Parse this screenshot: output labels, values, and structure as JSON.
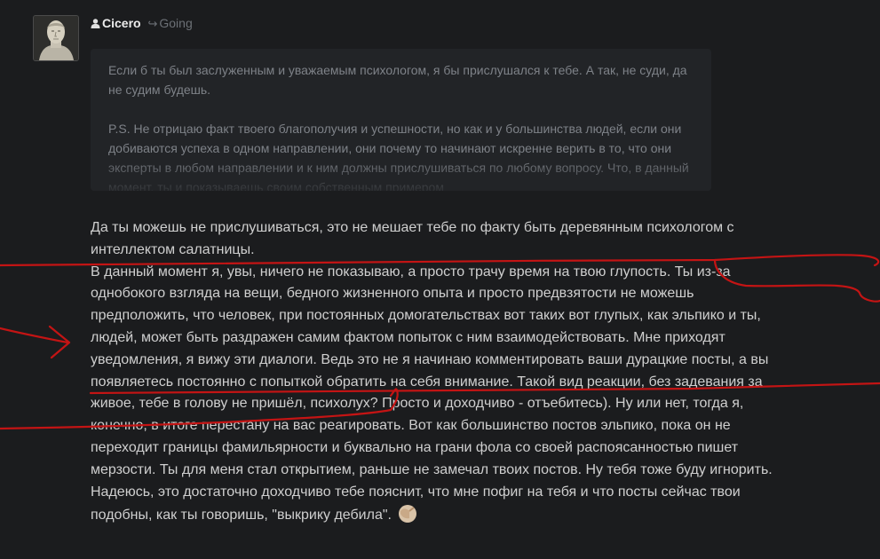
{
  "post": {
    "author": "Cicero",
    "reply_label": "Going",
    "avatar_icon": "bust-avatar",
    "quote": {
      "p1": "Если б ты был заслуженным и уважаемым психологом, я бы прислушался к тебе. А так, не суди, да не судим будешь.",
      "p2": "P.S. Не отрицаю факт твоего благополучия и успешности, но как и у большинства людей, если они добиваются успеха в одном направлении, они почему то начинают искренне верить в то, что они эксперты в любом направлении и к ним должны прислушиваться по любому вопросу. Что, в данный момент, ты и показываешь своим собственным примером"
    },
    "body": {
      "p1": "Да ты можешь не прислушиваться, это не мешает тебе по факту быть деревянным психологом с интеллектом салатницы.",
      "p2": "В данный момент я, увы, ничего не показываю, а просто трачу время на твою глупость. Ты из-за однобокого взгляда на вещи, бедного жизненного опыта и просто предвзятости не можешь предположить, что человек, при постоянных домогательствах вот таких вот глупых, как эльпико и ты, людей, может быть раздражен самим фактом попыток с ним взаимодействовать. Мне приходят уведомления, я вижу эти диалоги. Ведь это не я начинаю комментировать ваши дурацкие посты, а вы появляетесь постоянно с попыткой обратить на себя внимание. Такой вид реакции, без задевания за живое, тебе в голову не пришёл, психолух? Просто и доходчиво - отъебитесь). Ну или нет, тогда я, конечно, в итоге перестану на вас реагировать. Вот как большинство постов эльпико, пока он не переходит границы фамильярности и буквально на грани фола со своей распоясанностью пишет мерзости. Ты для меня стал открытием, раньше не замечал твоих постов. Ну тебя тоже буду игнорить. Надеюсь, это достаточно доходчиво тебе пояснит, что мне пофиг на тебя и что посты сейчас твои подобны, как ты говоришь, \"выкрику дебила\"."
    },
    "emoji_icon": "facepalm-emoji",
    "annotation_color": "#c41414"
  }
}
